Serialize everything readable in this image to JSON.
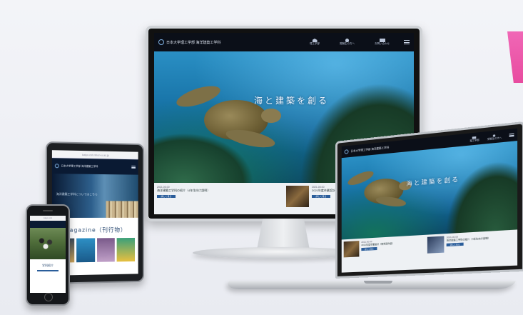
{
  "brand": {
    "name": "日本大学理工学部 海洋建築工学科",
    "accent": "#2a5d9a",
    "header_bg": "#0b0f18"
  },
  "nav": {
    "items": [
      {
        "label": "理工学部",
        "icon": "building-icon"
      },
      {
        "label": "受験生の方へ",
        "icon": "person-icon"
      },
      {
        "label": "お問い合わせ",
        "icon": "mail-icon"
      }
    ],
    "menu_icon": "hamburger-icon"
  },
  "hero": {
    "tagline": "海と建築を創る"
  },
  "news": [
    {
      "date": "2021.00.00",
      "title": "海洋建築工学科の紹介（4年生向け説明）",
      "button": "詳しく見る"
    },
    {
      "date": "2021.00.00",
      "title": "2021年度卒業設計（優秀賞作品）",
      "button": "詳しく見る"
    }
  ],
  "tablet": {
    "url": "kaiyo.cst.nihon-u.ac.jp",
    "hero_text": "海洋建築工学科についてはこちら",
    "magazine_title": "Magazine（刊行物）"
  },
  "phone": {
    "url": "kaiyo.cst",
    "label": "学科紹介"
  }
}
